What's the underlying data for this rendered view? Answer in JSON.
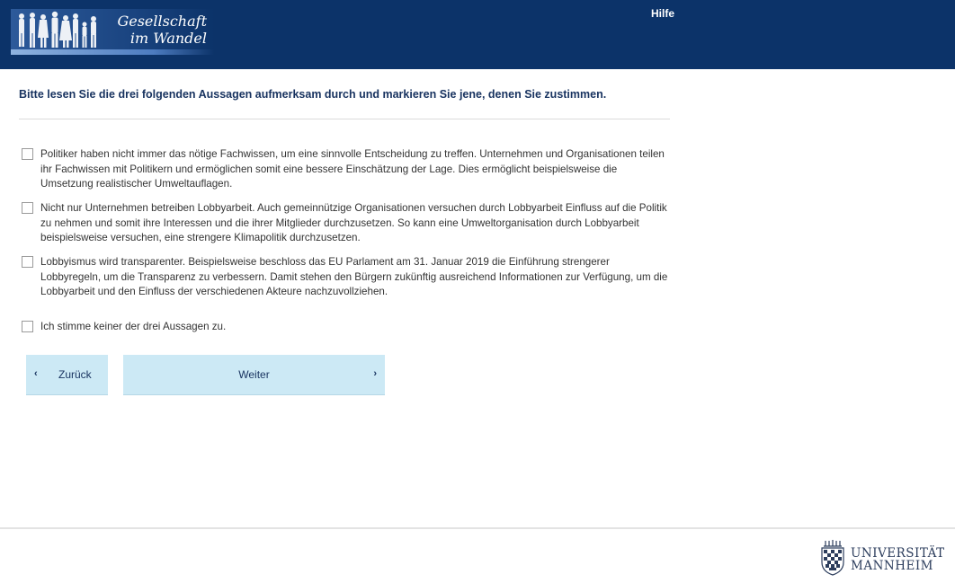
{
  "header": {
    "logo_line1": "Gesellschaft",
    "logo_line2": "im Wandel",
    "help_label": "Hilfe"
  },
  "question": "Bitte lesen Sie die drei folgenden Aussagen aufmerksam durch und markieren Sie jene, denen Sie zustimmen.",
  "options": [
    {
      "text": "Politiker haben nicht immer das nötige Fachwissen, um eine sinnvolle Entscheidung zu treffen. Unternehmen und Organisationen teilen ihr Fachwissen mit Politikern und ermöglichen somit eine bessere Einschätzung der Lage. Dies ermöglicht beispielsweise die Umsetzung realistischer Umweltauflagen.",
      "checked": false
    },
    {
      "text": "Nicht nur Unternehmen betreiben Lobbyarbeit. Auch gemeinnützige Organisationen versuchen durch Lobbyarbeit Einfluss auf die Politik zu nehmen und somit ihre Interessen und die ihrer Mitglieder durchzusetzen. So kann eine Umweltorganisation durch Lobbyarbeit beispielsweise versuchen, eine strengere Klimapolitik durchzusetzen.",
      "checked": false
    },
    {
      "text": "Lobbyismus wird transparenter. Beispielsweise beschloss das EU Parlament am 31. Januar 2019 die Einführung strengerer Lobbyregeln, um die Transparenz zu verbessern. Damit stehen den Bürgern zukünftig ausreichend Informationen zur Verfügung, um die Lobbyarbeit und den Einfluss der verschiedenen Akteure nachzuvollziehen.",
      "checked": false
    },
    {
      "text": "Ich stimme keiner der drei Aussagen zu.",
      "checked": false
    }
  ],
  "nav": {
    "back_label": "Zurück",
    "next_label": "Weiter",
    "back_icon": "chevron-left-icon",
    "next_icon": "chevron-right-icon"
  },
  "footer": {
    "uni_line1": "UNIVERSITÄT",
    "uni_line2": "MANNHEIM"
  },
  "colors": {
    "header_bg": "#0c3369",
    "button_bg": "#cce9f5",
    "text_dark_blue": "#17325f"
  }
}
